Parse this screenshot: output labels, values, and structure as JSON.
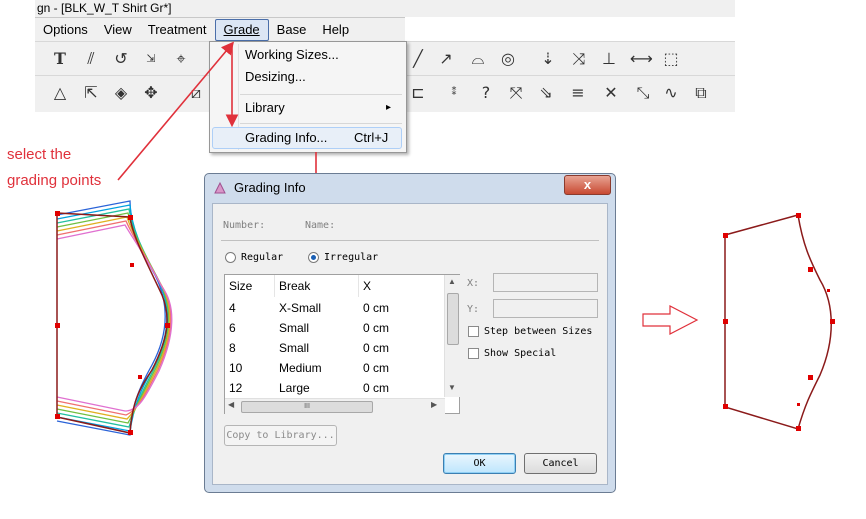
{
  "window": {
    "title": "gn - [BLK_W_T Shirt Gr*]"
  },
  "menubar": {
    "items": [
      "Options",
      "View",
      "Treatment",
      "Grade",
      "Base",
      "Help"
    ],
    "active": "Grade"
  },
  "grade_menu": {
    "items": [
      {
        "label": "Working Sizes...",
        "shortcut": ""
      },
      {
        "label": "Desizing...",
        "shortcut": ""
      },
      {
        "label": "Library",
        "shortcut": ""
      },
      {
        "label": "Grading Info...",
        "shortcut": "Ctrl+J"
      }
    ],
    "submenu_arrow": "▸"
  },
  "annotation": {
    "line1": "select the",
    "line2": "grading points"
  },
  "dialog": {
    "title": "Grading Info",
    "close": "x",
    "number_label": "Number:",
    "name_label": "Name:",
    "radio_regular": "Regular",
    "radio_irregular": "Irregular",
    "table": {
      "headers": [
        "Size",
        "Break",
        "X"
      ],
      "rows": [
        [
          "4",
          "X-Small",
          "0 cm"
        ],
        [
          "6",
          "Small",
          "0 cm"
        ],
        [
          "8",
          "Small",
          "0 cm"
        ],
        [
          "10",
          "Medium",
          "0 cm"
        ],
        [
          "12",
          "Large",
          "0 cm"
        ]
      ]
    },
    "x_label": "X:",
    "y_label": "Y:",
    "step_between_sizes": "Step between Sizes",
    "show_special": "Show Special",
    "copy_to_library": "Copy to Library...",
    "ok": "OK",
    "cancel": "Cancel",
    "hscroll_thumb": "III"
  },
  "colors": {
    "arrow_red": "#e0313b",
    "pattern_outline": "#8b1a1a",
    "point_red": "#e00000"
  },
  "icons": [
    "text-icon",
    "parallel-icon",
    "rotate-icon",
    "grade-icon",
    "curve-icon",
    "target-icon",
    "arrow-down-icon",
    "axis-icon"
  ]
}
